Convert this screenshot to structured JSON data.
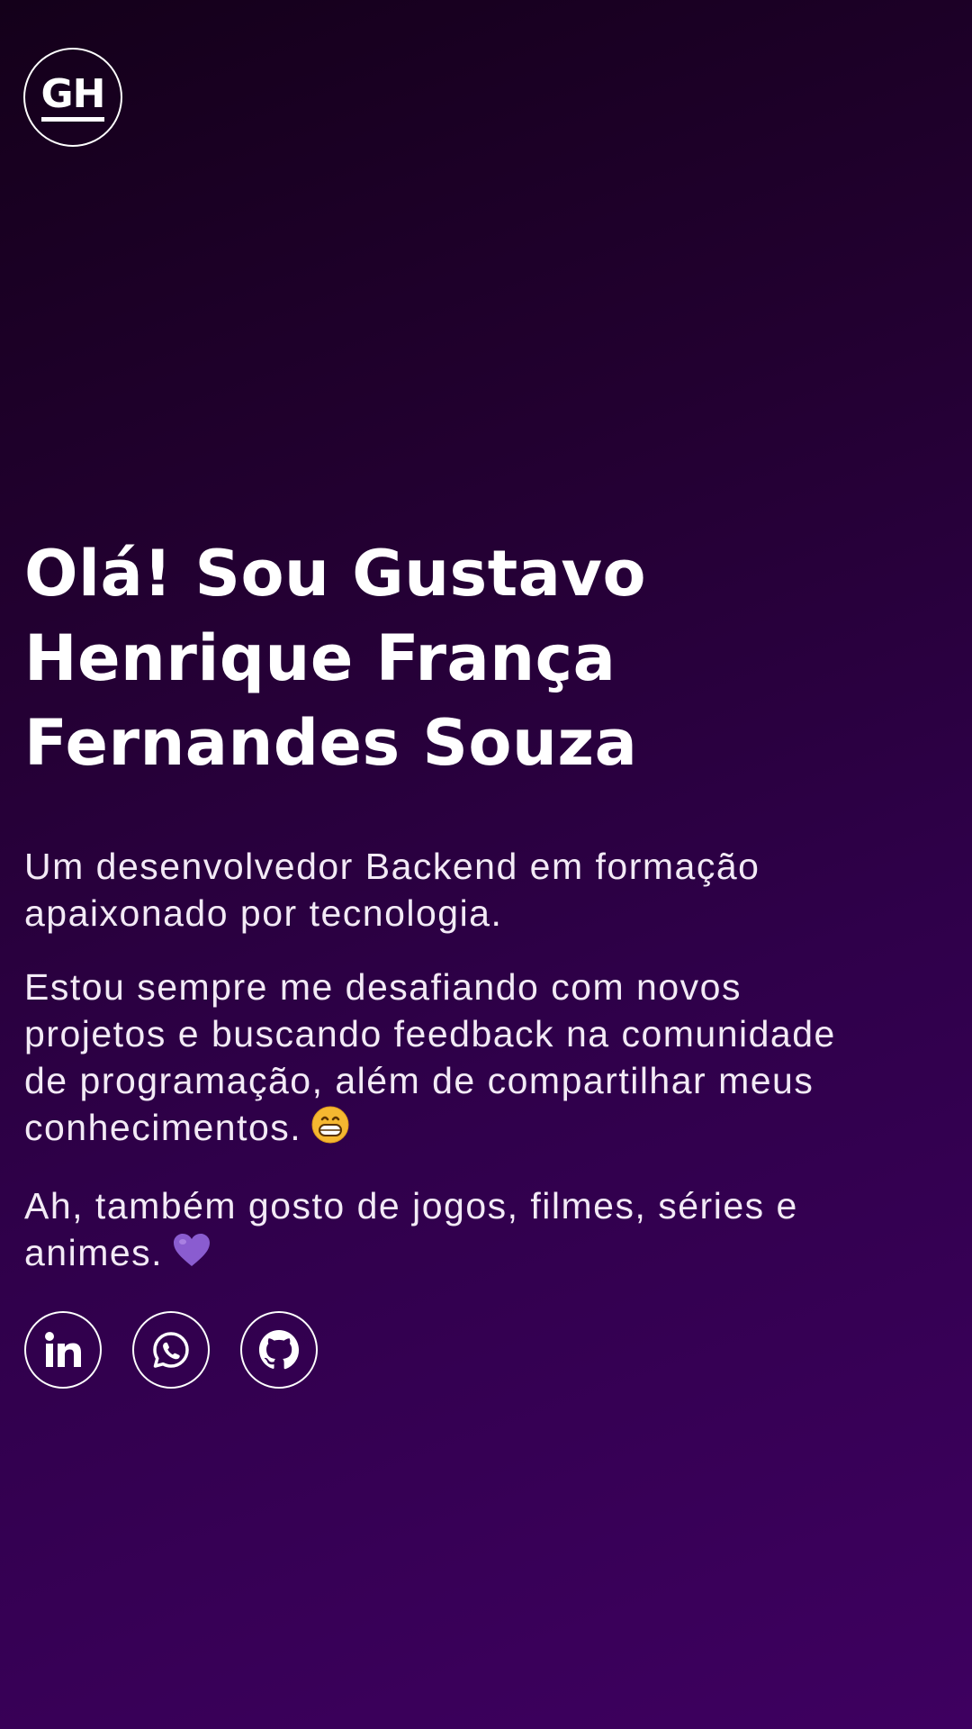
{
  "logo": {
    "text": "GH"
  },
  "hero": {
    "headline": "Olá! Sou Gustavo Henrique França Fernandes Souza",
    "paragraph_1": "Um desenvolvedor Backend em formação apaixonado por tecnologia.",
    "paragraph_2": "Estou sempre me desafiando com novos projetos e buscando feedback na comunidade de programação, além de compartilhar meus conhecimentos.",
    "paragraph_3": "Ah, também gosto de jogos, filmes, séries e animes."
  },
  "icons": {
    "grin_emoji": "grinning-face-emoji-icon",
    "heart_emoji": "purple-heart-emoji-icon"
  },
  "social": [
    {
      "icon": "linkedin-icon"
    },
    {
      "icon": "whatsapp-icon"
    },
    {
      "icon": "github-icon"
    }
  ],
  "colors": {
    "background_start": "#14001a",
    "background_end": "#3e0060",
    "text": "#ffffff",
    "heart": "#8a5cd0",
    "emoji": "#f5b731"
  }
}
